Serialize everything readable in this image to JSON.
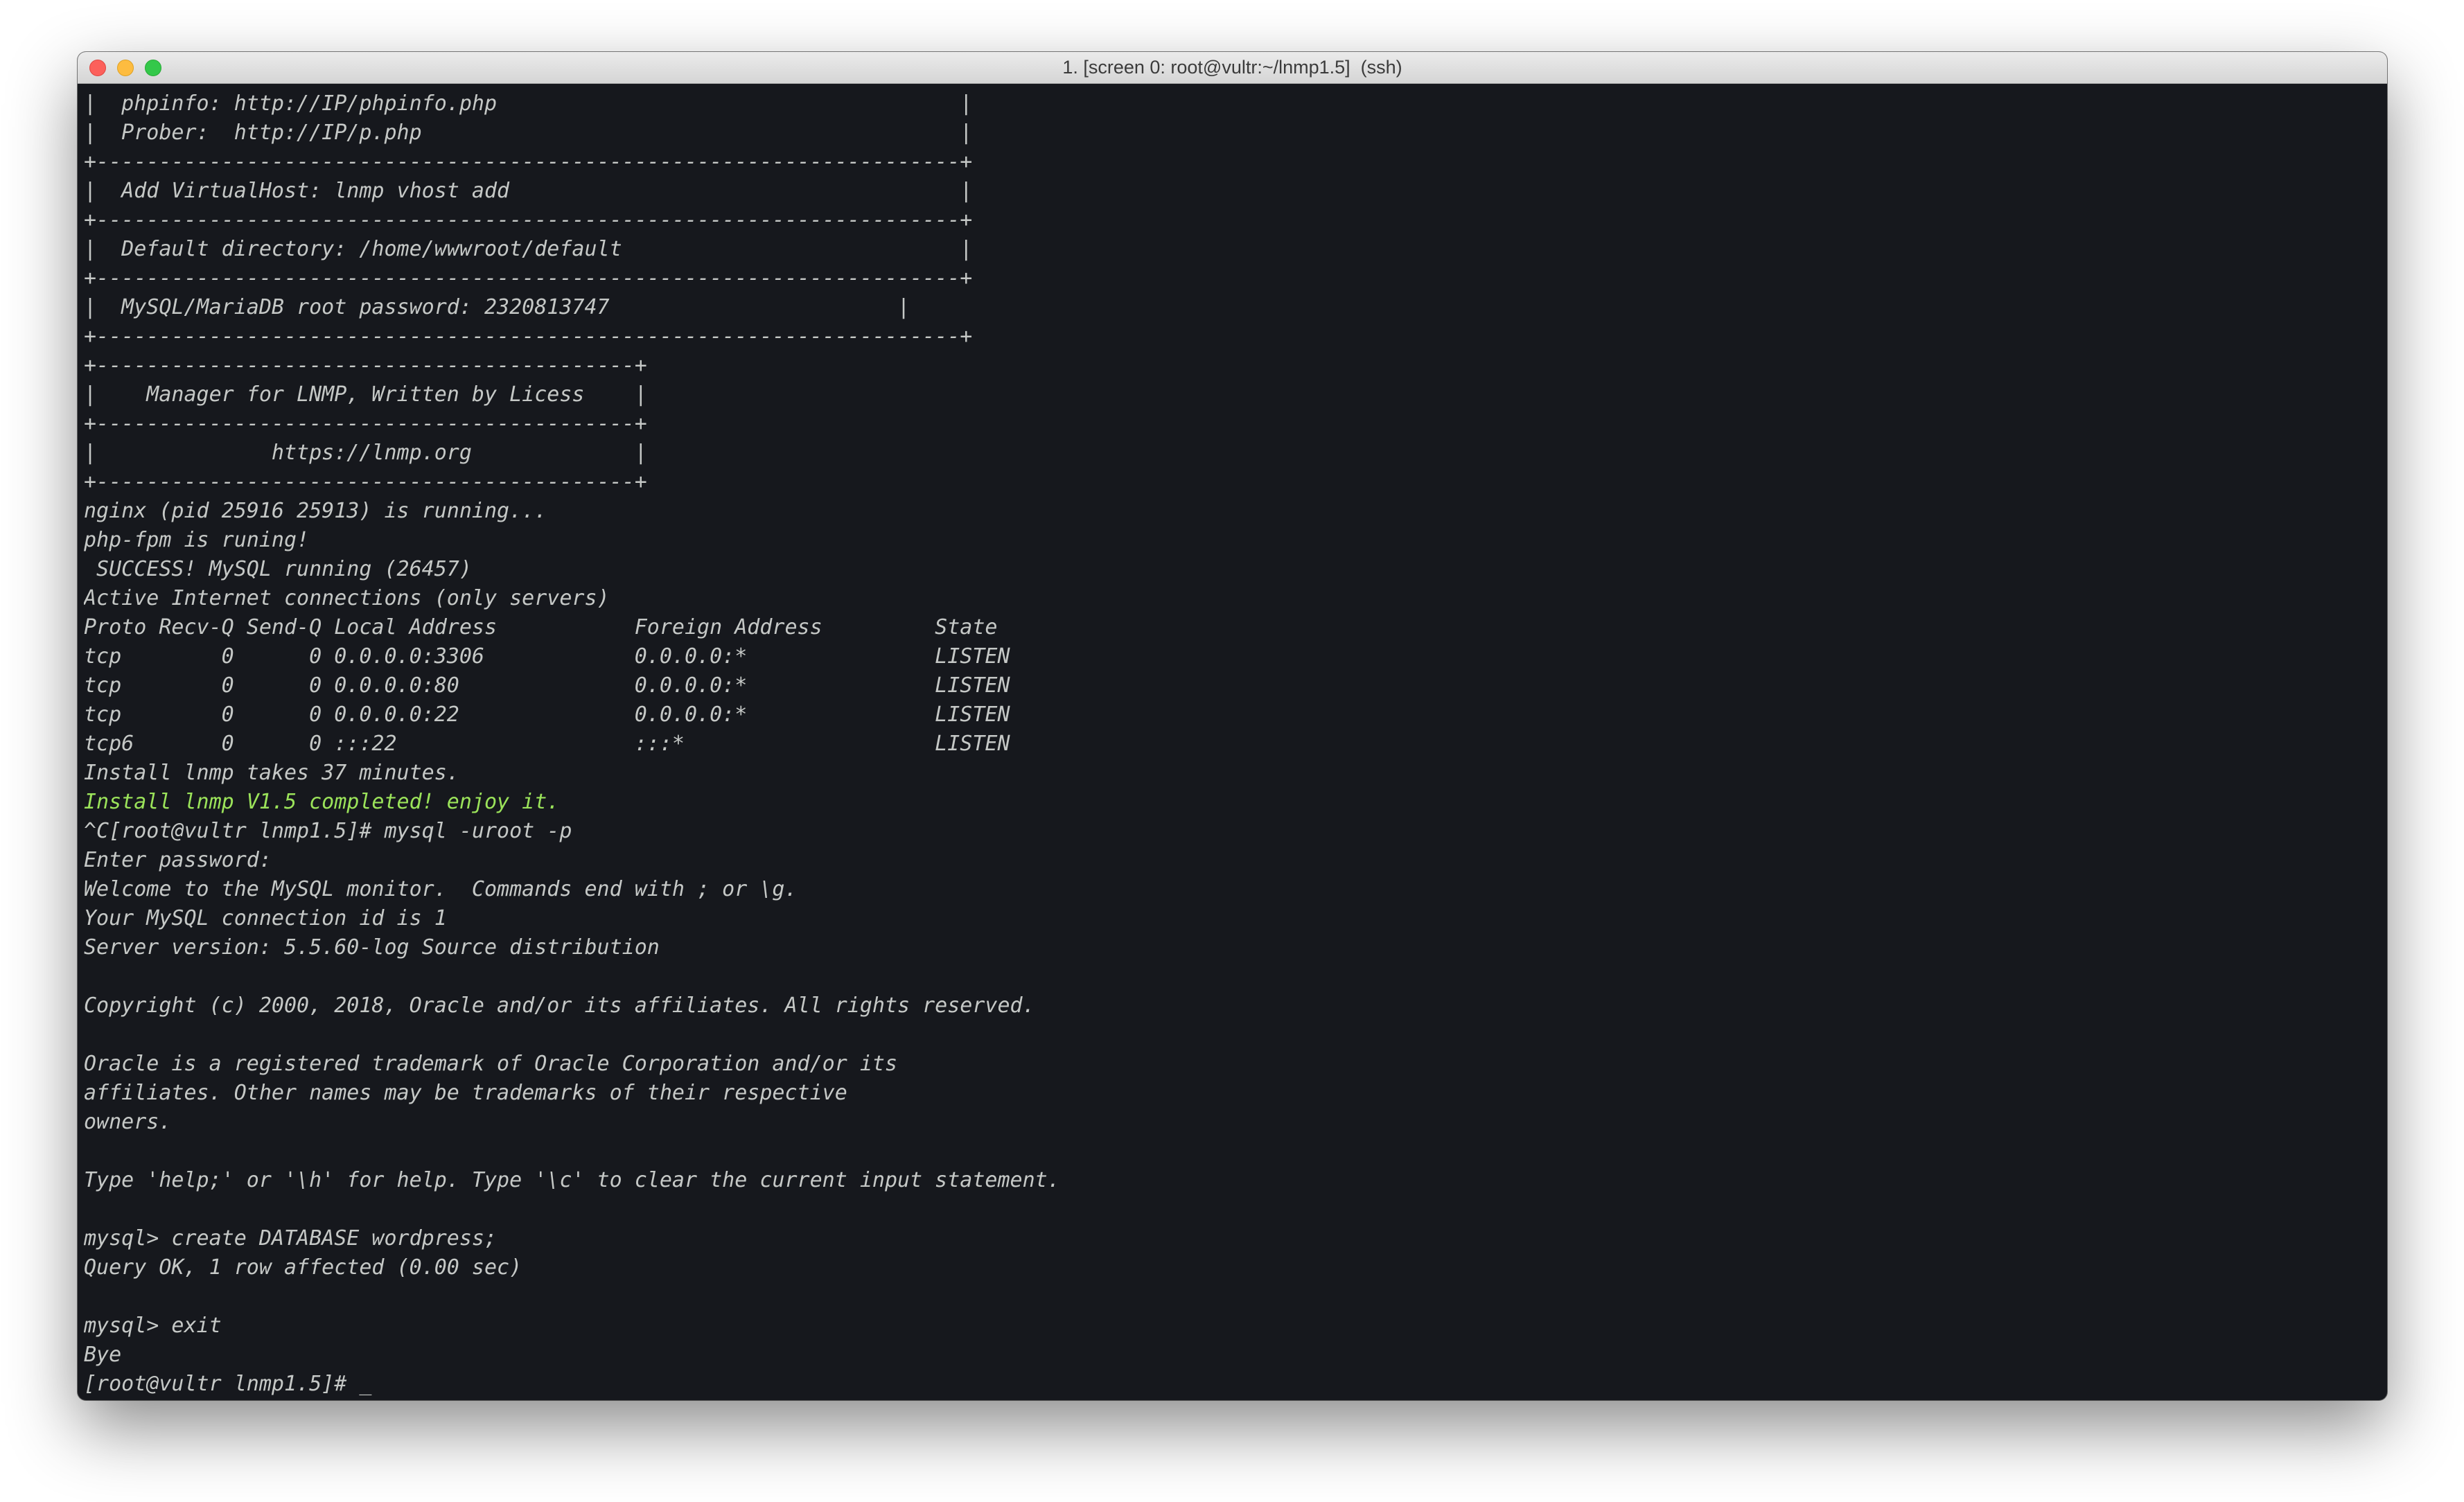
{
  "window": {
    "title": "1. [screen 0: root@vultr:~/lnmp1.5]  (ssh)"
  },
  "colors": {
    "terminal_background": "#16181d",
    "terminal_text": "#c5c8c6",
    "success_text": "#9be35a",
    "close_button": "#fc605b",
    "minimize_button": "#fdbc40",
    "maximize_button": "#34c84a"
  },
  "terminal": {
    "lines": [
      "|  phpinfo: http://IP/phpinfo.php                                     |",
      "|  Prober:  http://IP/p.php                                           |",
      "+---------------------------------------------------------------------+",
      "|  Add VirtualHost: lnmp vhost add                                    |",
      "+---------------------------------------------------------------------+",
      "|  Default directory: /home/wwwroot/default                           |",
      "+---------------------------------------------------------------------+",
      "|  MySQL/MariaDB root password: 2320813747                       |",
      "+---------------------------------------------------------------------+",
      "+-------------------------------------------+",
      "|    Manager for LNMP, Written by Licess    |",
      "+-------------------------------------------+",
      "|              https://lnmp.org             |",
      "+-------------------------------------------+",
      "nginx (pid 25916 25913) is running...",
      "php-fpm is runing!",
      " SUCCESS! MySQL running (26457)",
      "Active Internet connections (only servers)",
      "Proto Recv-Q Send-Q Local Address           Foreign Address         State",
      "tcp        0      0 0.0.0.0:3306            0.0.0.0:*               LISTEN",
      "tcp        0      0 0.0.0.0:80              0.0.0.0:*               LISTEN",
      "tcp        0      0 0.0.0.0:22              0.0.0.0:*               LISTEN",
      "tcp6       0      0 :::22                   :::*                    LISTEN",
      "Install lnmp takes 37 minutes.",
      "Install lnmp V1.5 completed! enjoy it.",
      "^C[root@vultr lnmp1.5]# mysql -uroot -p",
      "Enter password:",
      "Welcome to the MySQL monitor.  Commands end with ; or \\g.",
      "Your MySQL connection id is 1",
      "Server version: 5.5.60-log Source distribution",
      "",
      "Copyright (c) 2000, 2018, Oracle and/or its affiliates. All rights reserved.",
      "",
      "Oracle is a registered trademark of Oracle Corporation and/or its",
      "affiliates. Other names may be trademarks of their respective",
      "owners.",
      "",
      "Type 'help;' or '\\h' for help. Type '\\c' to clear the current input statement.",
      "",
      "mysql> create DATABASE wordpress;",
      "Query OK, 1 row affected (0.00 sec)",
      "",
      "mysql> exit",
      "Bye"
    ],
    "prompt": "[root@vultr lnmp1.5]# ",
    "cursor": "_"
  }
}
